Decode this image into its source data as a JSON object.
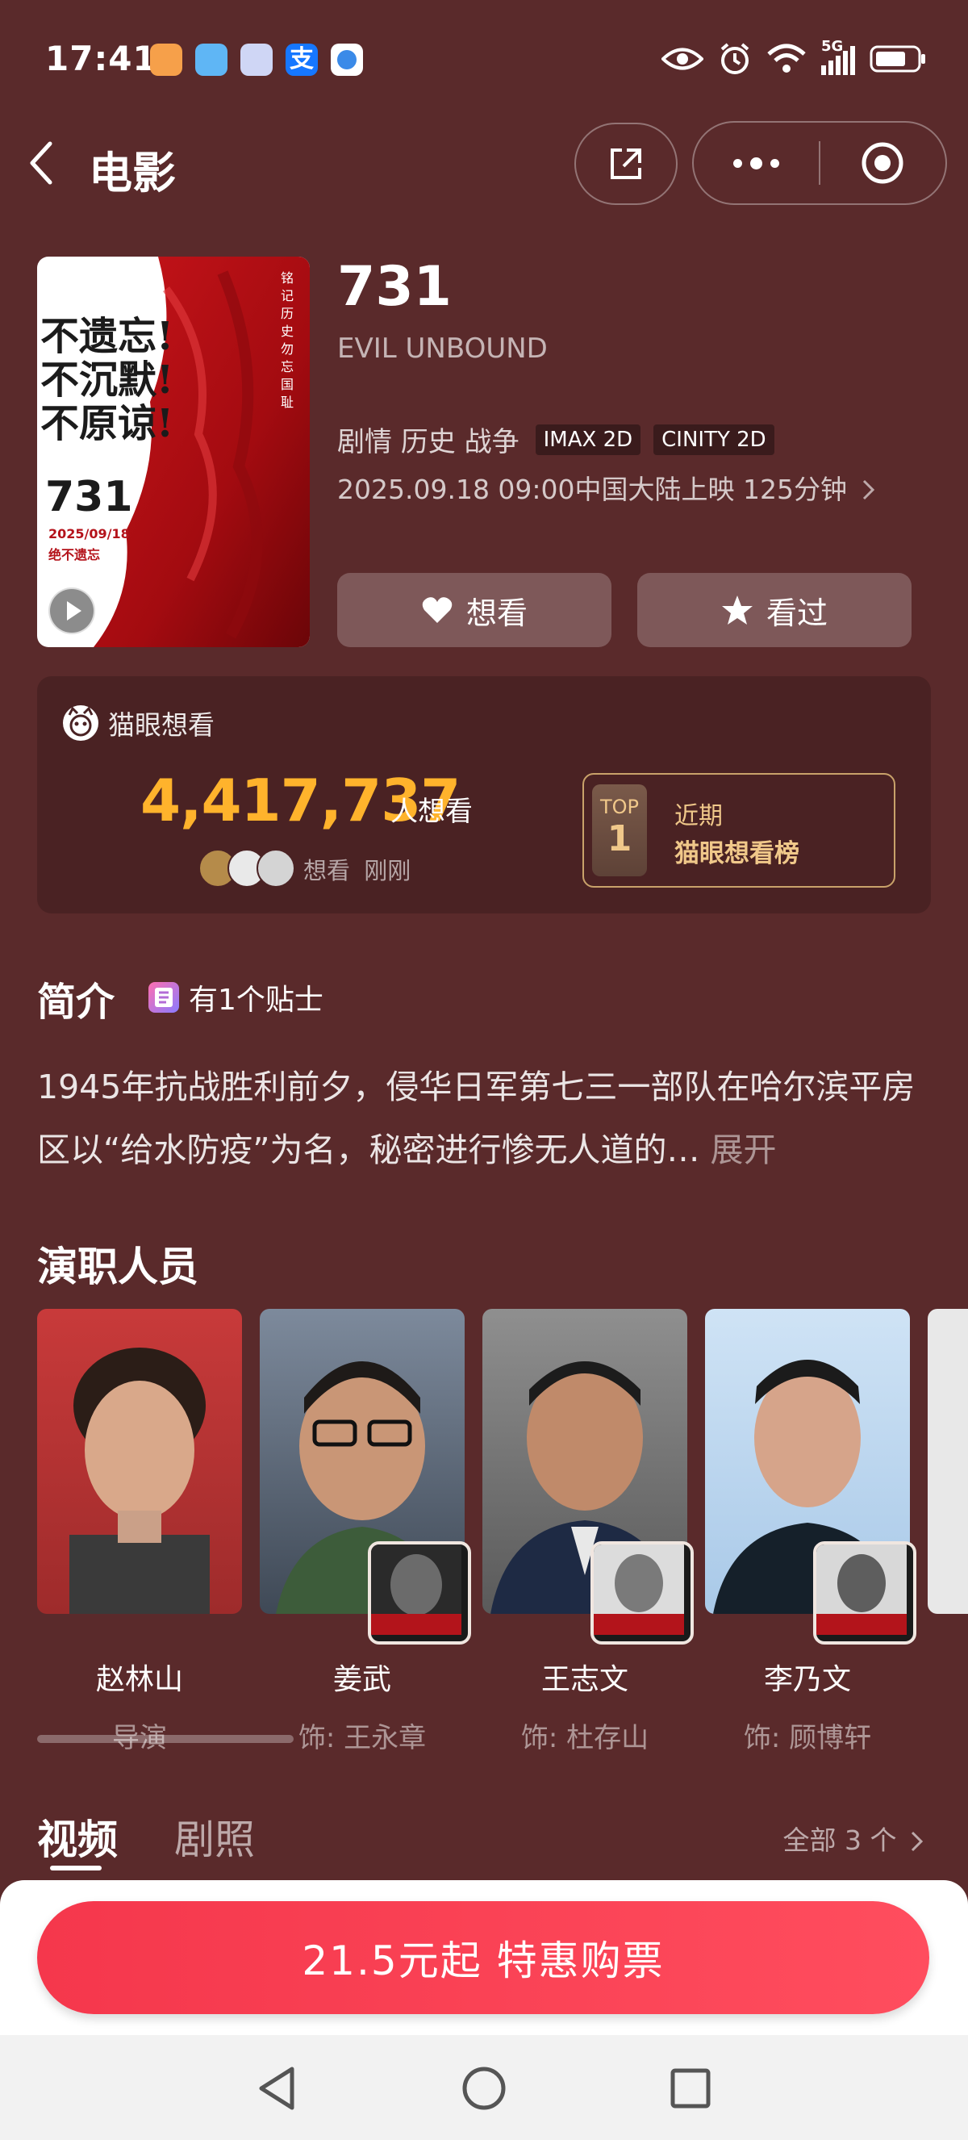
{
  "status_bar": {
    "time": "17:41",
    "network": "5G"
  },
  "nav": {
    "title": "电影"
  },
  "movie": {
    "title": "731",
    "english_title": "EVIL UNBOUND",
    "genres": "剧情 历史 战争",
    "formats": [
      "IMAX 2D",
      "CINITY 2D"
    ],
    "release_info": "2025.09.18 09:00中国大陆上映 125分钟",
    "poster": {
      "slogan": [
        "不遗忘!",
        "不沉默!",
        "不原谅!"
      ],
      "big_number": "731",
      "date": "2025/09/18",
      "tagline": "绝不遗忘",
      "vertical_text": "铭记历史 勿忘国耻"
    }
  },
  "actions": {
    "want_label": "想看",
    "seen_label": "看过"
  },
  "want": {
    "source": "猫眼想看",
    "count": "4,417,737",
    "unit": "人想看",
    "recent_verb": "想看",
    "recent_time": "刚刚",
    "rank_top": "TOP",
    "rank_num": "1",
    "rank_period": "近期",
    "rank_name": "猫眼想看榜"
  },
  "intro": {
    "title": "简介",
    "tip": "有1个贴士",
    "text": "1945年抗战胜利前夕，侵华日军第七三一部队在哈尔滨平房区以“给水防疫”为名，秘密进行惨无人道的…",
    "expand": "展开"
  },
  "cast": {
    "title": "演职人员",
    "members": [
      {
        "name": "赵林山",
        "role": "导演"
      },
      {
        "name": "姜武",
        "role": "饰: 王永章"
      },
      {
        "name": "王志文",
        "role": "饰: 杜存山"
      },
      {
        "name": "李乃文",
        "role": "饰: 顾博轩"
      }
    ]
  },
  "media_tabs": {
    "videos": "视频",
    "stills": "剧照",
    "all": "全部 3 个"
  },
  "buy": {
    "label": "21.5元起 特惠购票"
  },
  "colors": {
    "background": "#5a2a2b",
    "accent_count": "#ffb32c",
    "buy_button": "#f5374c"
  }
}
